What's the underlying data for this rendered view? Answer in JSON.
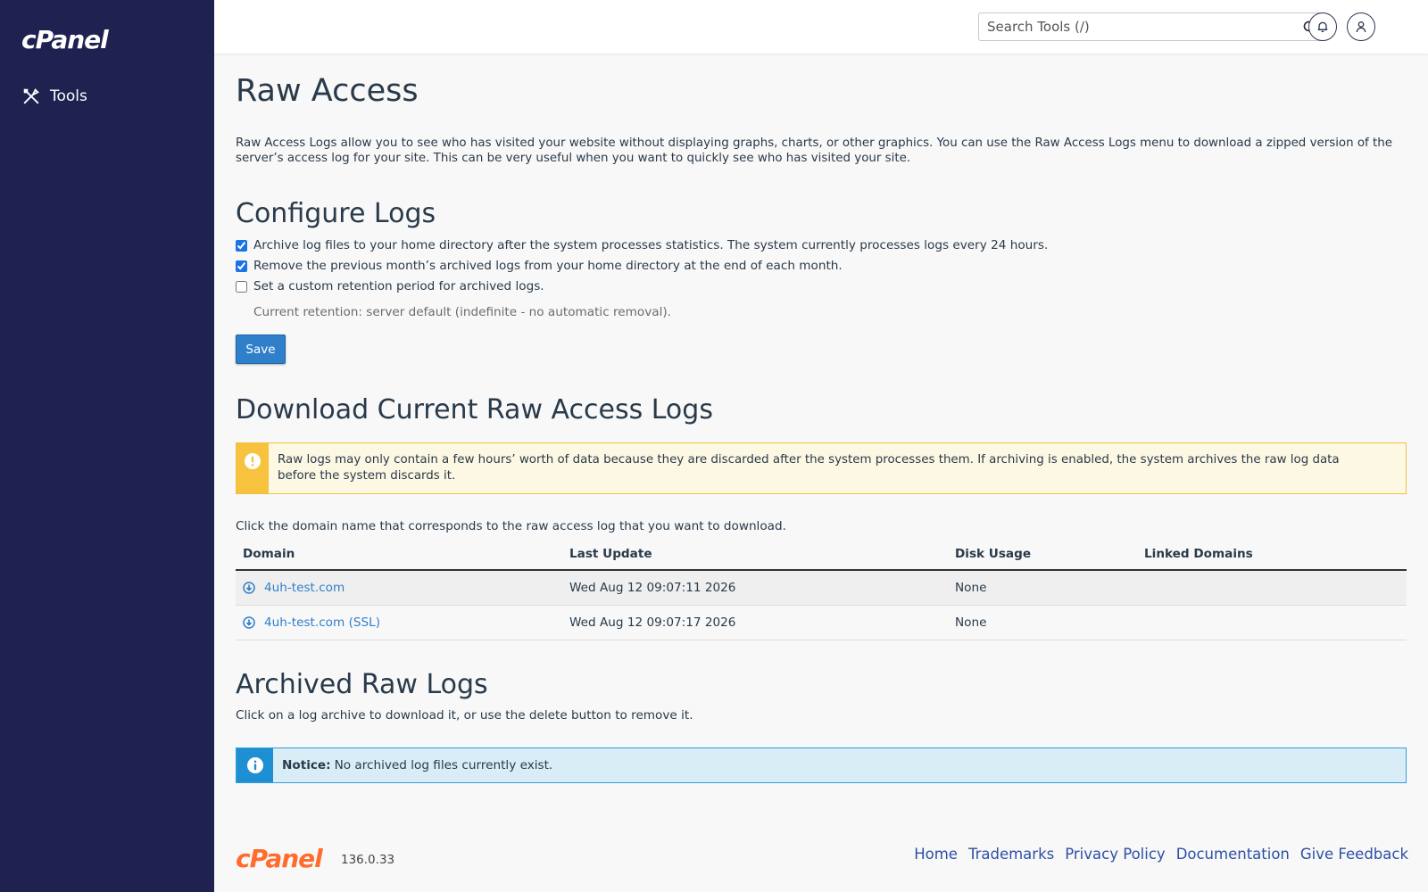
{
  "sidebar": {
    "logo": "cPanel",
    "items": [
      {
        "label": "Tools",
        "icon": "tools-icon"
      }
    ]
  },
  "topbar": {
    "search_placeholder": "Search Tools (/)"
  },
  "page": {
    "title": "Raw Access",
    "intro": "Raw Access Logs allow you to see who has visited your website without displaying graphs, charts, or other graphics. You can use the Raw Access Logs menu to download a zipped version of the server’s access log for your site. This can be very useful when you want to quickly see who has visited your site."
  },
  "configure": {
    "heading": "Configure Logs",
    "options": [
      {
        "label": "Archive log files to your home directory after the system processes statistics. The system currently processes logs every 24 hours.",
        "checked": true
      },
      {
        "label": "Remove the previous month’s archived logs from your home directory at the end of each month.",
        "checked": true
      },
      {
        "label": "Set a custom retention period for archived logs.",
        "checked": false
      }
    ],
    "retention_note": "Current retention: server default (indefinite - no automatic removal).",
    "save_label": "Save"
  },
  "download": {
    "heading": "Download Current Raw Access Logs",
    "warning": "Raw logs may only contain a few hours’ worth of data because they are discarded after the system processes them. If archiving is enabled, the system archives the raw log data before the system discards it.",
    "instruction": "Click the domain name that corresponds to the raw access log that you want to download.",
    "columns": [
      "Domain",
      "Last Update",
      "Disk Usage",
      "Linked Domains"
    ],
    "rows": [
      {
        "domain": "4uh-test.com",
        "last_update": "Wed Aug 12 09:07:11 2026",
        "disk_usage": "None",
        "linked": ""
      },
      {
        "domain": "4uh-test.com (SSL)",
        "last_update": "Wed Aug 12 09:07:17 2026",
        "disk_usage": "None",
        "linked": ""
      }
    ]
  },
  "archived": {
    "heading": "Archived Raw Logs",
    "instruction": "Click on a log archive to download it, or use the delete button to remove it.",
    "notice_label": "Notice:",
    "notice_text": "No archived log files currently exist."
  },
  "footer": {
    "logo": "cPanel",
    "version": "136.0.33",
    "links": [
      "Home",
      "Trademarks",
      "Privacy Policy",
      "Documentation",
      "Give Feedback"
    ]
  },
  "colors": {
    "sidebar": "#1f2251",
    "accent": "#2f7fcb",
    "warning": "#f7c23d",
    "info": "#1e8fd2",
    "brand_orange": "#ff6c2c"
  }
}
